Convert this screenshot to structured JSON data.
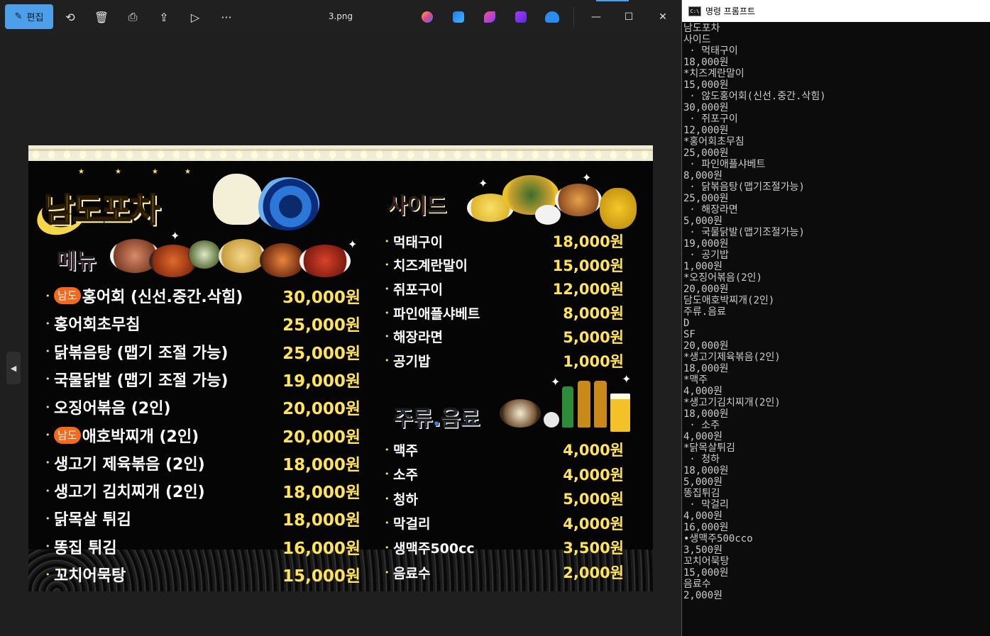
{
  "photos_toolbar": {
    "edit_label": "편집",
    "file_title": "3.png",
    "more_label": "···",
    "min_label": "—",
    "max_label": "☐",
    "close_label": "✕",
    "prev_label": "◀"
  },
  "menu_image": {
    "brand": "남도포차",
    "menu_section": "메뉴",
    "side_section": "사이드",
    "drinks_section": "주류.음료",
    "badge": "남도",
    "main_items": [
      {
        "name": "홍어회 (신선.중간.삭힘)",
        "price": "30,000원",
        "badge": true
      },
      {
        "name": "홍어회초무침",
        "price": "25,000원",
        "badge": false
      },
      {
        "name": "닭볶음탕 (맵기 조절 가능)",
        "price": "25,000원",
        "badge": false
      },
      {
        "name": "국물닭발 (맵기 조절 가능)",
        "price": "19,000원",
        "badge": false
      },
      {
        "name": "오징어볶음 (2인)",
        "price": "20,000원",
        "badge": false
      },
      {
        "name": "애호박찌개 (2인)",
        "price": "20,000원",
        "badge": true
      },
      {
        "name": "생고기 제육볶음 (2인)",
        "price": "18,000원",
        "badge": false
      },
      {
        "name": "생고기 김치찌개 (2인)",
        "price": "18,000원",
        "badge": false
      },
      {
        "name": "닭목살 튀김",
        "price": "18,000원",
        "badge": false
      },
      {
        "name": "똥집 튀김",
        "price": "16,000원",
        "badge": false
      },
      {
        "name": "꼬치어묵탕",
        "price": "15,000원",
        "badge": false
      }
    ],
    "side_items": [
      {
        "name": "먹태구이",
        "price": "18,000원"
      },
      {
        "name": "치즈계란말이",
        "price": "15,000원"
      },
      {
        "name": "쥐포구이",
        "price": "12,000원"
      },
      {
        "name": "파인애플샤베트",
        "price": "8,000원"
      },
      {
        "name": "해장라면",
        "price": "5,000원"
      },
      {
        "name": "공기밥",
        "price": "1,000원"
      }
    ],
    "drink_items": [
      {
        "name": "맥주",
        "price": "4,000원"
      },
      {
        "name": "소주",
        "price": "4,000원"
      },
      {
        "name": "청하",
        "price": "5,000원"
      },
      {
        "name": "막걸리",
        "price": "4,000원"
      },
      {
        "name": "생맥주500cc",
        "price": "3,500원"
      },
      {
        "name": "음료수",
        "price": "2,000원"
      }
    ]
  },
  "cmd": {
    "title": "명령 프롬프트",
    "icon_text": "C:\\",
    "lines": [
      "남도포차",
      "사이드",
      " · 먹태구이",
      "18,000원",
      "*치즈계란말이",
      "15,000원",
      " · 않도홍어회(신선.중간.삭힘)",
      "30,000원",
      " · 쥐포구이",
      "12,000원",
      "*홍어회초무침",
      "25,000원",
      " · 파인애플샤베트",
      "8,000원",
      " · 닭볶음탕(맵기조절가능)",
      "25,000원",
      " · 해장라면",
      "5,000원",
      " · 국물닭발(맵기조절가능)",
      "19,000원",
      " · 공기밥",
      "1,000원",
      "*오징어볶음(2인)",
      "20,000원",
      "담도애호박찌개(2인)",
      "주류.음료",
      "D",
      "SF",
      "20,000원",
      "*생고기제육볶음(2인)",
      "18,000원",
      "*맥주",
      "4,000원",
      "*생고기김치찌개(2인)",
      "18,000원",
      " · 소주",
      "4,000원",
      "*닭목살튀김",
      " · 청하",
      "18,000원",
      "5,000원",
      "똥집튀김",
      " · 막걸리",
      "4,000원",
      "16,000원",
      "•생맥주500cco",
      "3,500원",
      "꼬치어묵탕",
      "15,000원",
      "음료수",
      "2,000원"
    ]
  },
  "colors": {
    "accent": "#4c9fe8",
    "menu_price": "#ffe35c",
    "badge": "#f36a1e"
  }
}
